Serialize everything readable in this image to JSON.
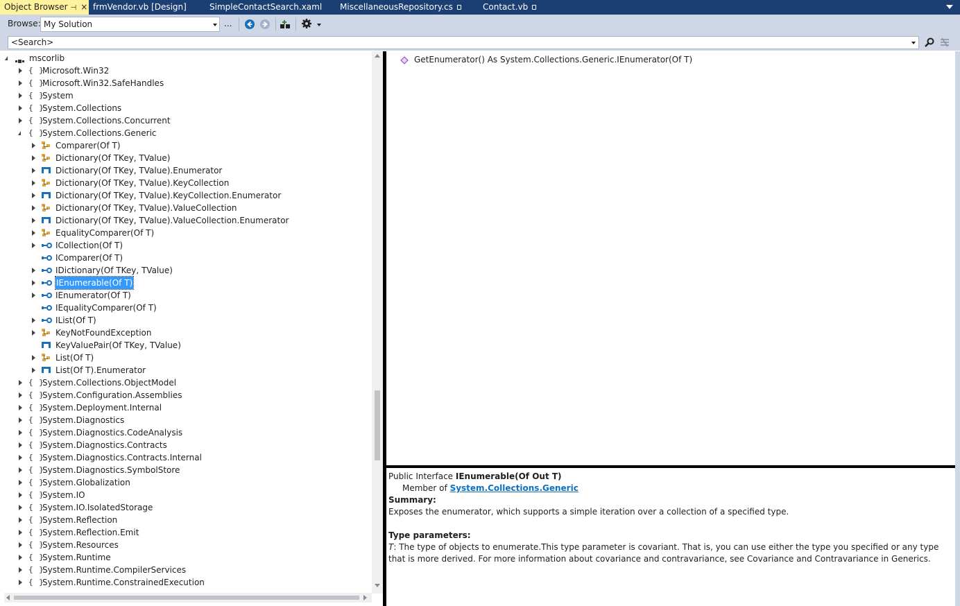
{
  "tabs": [
    {
      "label": "Object Browser",
      "active": true,
      "pin": "⊣",
      "close": "×"
    },
    {
      "label": "frmVendor.vb [Design]"
    },
    {
      "label": "SimpleContactSearch.xaml"
    },
    {
      "label": "MiscellaneousRepository.cs",
      "locked": true
    },
    {
      "label": "Contact.vb",
      "locked": true
    }
  ],
  "toolbar": {
    "browse_label": "Browse:",
    "browse_value": "My Solution",
    "ellipsis": "...",
    "icons": [
      "back-icon",
      "forward-icon",
      "add-reference-icon",
      "settings-icon"
    ]
  },
  "search": {
    "placeholder": "<Search>"
  },
  "tree": {
    "root": "mscorlib",
    "namespaces_before": [
      "Microsoft.Win32",
      "Microsoft.Win32.SafeHandles",
      "System",
      "System.Collections",
      "System.Collections.Concurrent"
    ],
    "expanded_namespace": "System.Collections.Generic",
    "types": [
      {
        "label": "Comparer(Of T)",
        "kind": "class",
        "expandable": true
      },
      {
        "label": "Dictionary(Of TKey, TValue)",
        "kind": "class",
        "expandable": true
      },
      {
        "label": "Dictionary(Of TKey, TValue).Enumerator",
        "kind": "struct",
        "expandable": true
      },
      {
        "label": "Dictionary(Of TKey, TValue).KeyCollection",
        "kind": "class",
        "expandable": true
      },
      {
        "label": "Dictionary(Of TKey, TValue).KeyCollection.Enumerator",
        "kind": "struct",
        "expandable": true
      },
      {
        "label": "Dictionary(Of TKey, TValue).ValueCollection",
        "kind": "class",
        "expandable": true
      },
      {
        "label": "Dictionary(Of TKey, TValue).ValueCollection.Enumerator",
        "kind": "struct",
        "expandable": true
      },
      {
        "label": "EqualityComparer(Of T)",
        "kind": "class",
        "expandable": true
      },
      {
        "label": "ICollection(Of T)",
        "kind": "interface",
        "expandable": true
      },
      {
        "label": "IComparer(Of T)",
        "kind": "interface",
        "expandable": false
      },
      {
        "label": "IDictionary(Of TKey, TValue)",
        "kind": "interface",
        "expandable": true
      },
      {
        "label": "IEnumerable(Of T)",
        "kind": "interface",
        "expandable": true,
        "selected": true
      },
      {
        "label": "IEnumerator(Of T)",
        "kind": "interface",
        "expandable": true
      },
      {
        "label": "IEqualityComparer(Of T)",
        "kind": "interface",
        "expandable": false
      },
      {
        "label": "IList(Of T)",
        "kind": "interface",
        "expandable": true
      },
      {
        "label": "KeyNotFoundException",
        "kind": "class",
        "expandable": true
      },
      {
        "label": "KeyValuePair(Of TKey, TValue)",
        "kind": "struct",
        "expandable": false
      },
      {
        "label": "List(Of T)",
        "kind": "class",
        "expandable": true
      },
      {
        "label": "List(Of T).Enumerator",
        "kind": "struct",
        "expandable": true
      }
    ],
    "namespaces_after": [
      "System.Collections.ObjectModel",
      "System.Configuration.Assemblies",
      "System.Deployment.Internal",
      "System.Diagnostics",
      "System.Diagnostics.CodeAnalysis",
      "System.Diagnostics.Contracts",
      "System.Diagnostics.Contracts.Internal",
      "System.Diagnostics.SymbolStore",
      "System.Globalization",
      "System.IO",
      "System.IO.IsolatedStorage",
      "System.Reflection",
      "System.Reflection.Emit",
      "System.Resources",
      "System.Runtime",
      "System.Runtime.CompilerServices",
      "System.Runtime.ConstrainedExecution"
    ],
    "ns_glyph": "{ }"
  },
  "members": [
    {
      "label": "GetEnumerator() As System.Collections.Generic.IEnumerator(Of T)"
    }
  ],
  "description": {
    "decl_prefix": "Public Interface ",
    "decl_name": "IEnumerable(Of Out T)",
    "member_of_prefix": "Member of ",
    "member_of_links": [
      "System",
      "Collections",
      "Generic"
    ],
    "summary_heading": "Summary:",
    "summary_text": "Exposes the enumerator, which supports a simple iteration over a collection of a specified type.",
    "type_params_heading": "Type parameters:",
    "type_param_name": "T",
    "type_param_text": ": The type of objects to enumerate.This type parameter is covariant. That is, you can use either the type you specified or any type that is more derived. For more information about covariance and contravariance, see Covariance and Contravariance in Generics."
  },
  "colors": {
    "tab_strip": "#1c3f73",
    "active_tab": "#fff29d",
    "toolbar": "#cfd6e5",
    "selection": "#3399ff",
    "link": "#0e70c0"
  }
}
